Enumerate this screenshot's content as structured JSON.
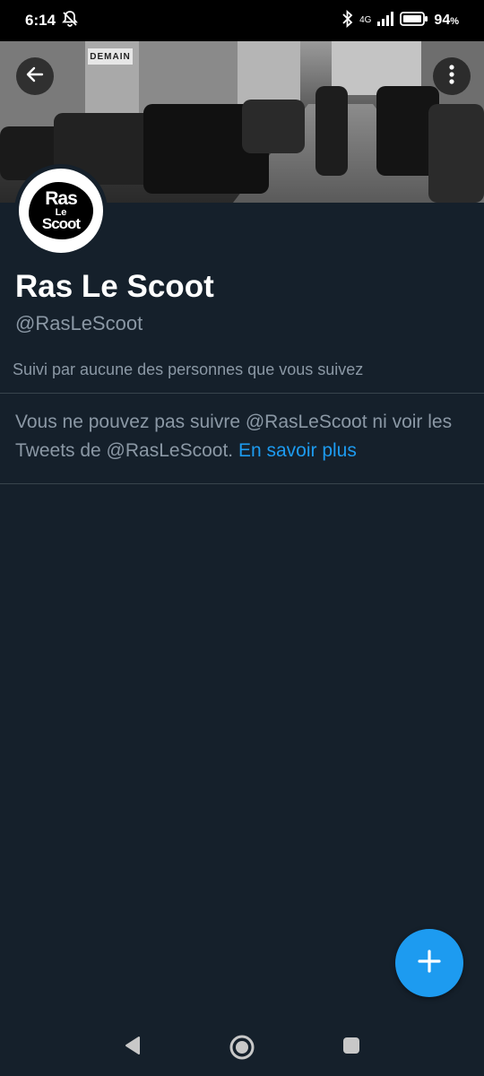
{
  "status_bar": {
    "time": "6:14",
    "network": "4G",
    "battery_percent": "94",
    "battery_unit": "%"
  },
  "profile": {
    "avatar_text": [
      "Ras",
      "Le",
      "Scoot"
    ],
    "banner_sign": "DEMAIN",
    "display_name": "Ras Le Scoot",
    "handle": "@RasLeScoot",
    "followed_by": "Suivi par aucune des personnes que vous suivez",
    "protected_notice": "Vous ne pouvez pas suivre @RasLeScoot ni voir les Tweets de @RasLeScoot.",
    "learn_more": "En savoir plus"
  },
  "icons": {
    "back": "back-arrow-icon",
    "more": "more-vertical-icon",
    "fab": "plus-icon",
    "nav_back": "triangle-back-icon",
    "nav_home": "circle-home-icon",
    "nav_recent": "square-recent-icon"
  },
  "colors": {
    "background": "#15202b",
    "accent": "#1d9bf0",
    "secondary_text": "#8b98a5",
    "divider": "#38444d"
  }
}
